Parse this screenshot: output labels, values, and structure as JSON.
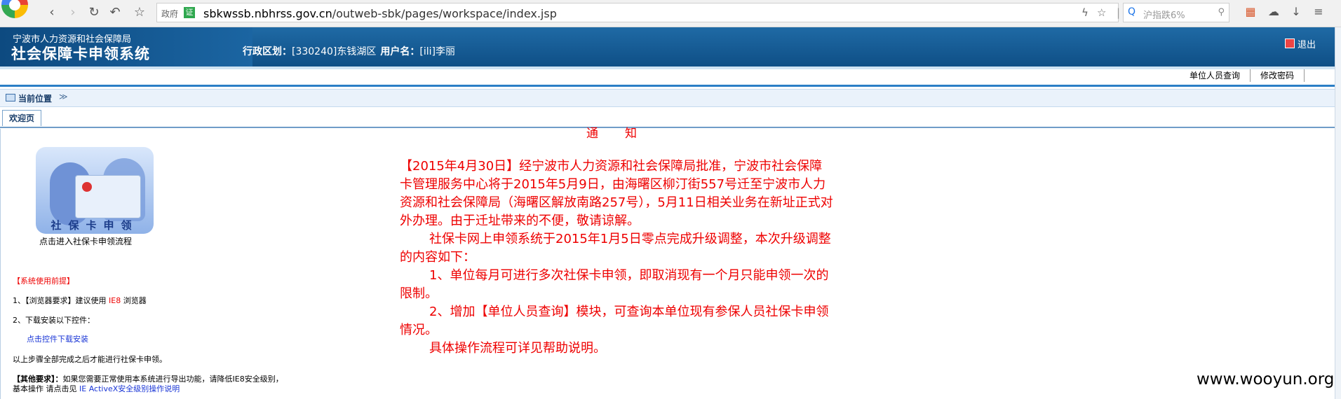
{
  "browser": {
    "gov_badge": "政府",
    "cert_badge": "证",
    "url_host": "sbkwssb.nbhrss.gov.cn",
    "url_path": "/outweb-sbk/pages/workspace/index.jsp",
    "search_placeholder": "沪指跌6%"
  },
  "header": {
    "org_name": "宁波市人力资源和社会保障局",
    "system_name": "社会保障卡申领系统",
    "region_label": "行政区划：",
    "region_value": "[330240]东钱湖区",
    "user_label": "用户名：",
    "user_value": "[ili]李丽",
    "logout_label": "退出"
  },
  "sublinks": {
    "staff_query": "单位人员查询",
    "change_password": "修改密码"
  },
  "breadcrumb": {
    "label": "当前位置",
    "arrows": "≫"
  },
  "tabs": [
    {
      "label": "欢迎页"
    }
  ],
  "card": {
    "caption_text": "社保卡申领",
    "link_text": "点击进入社保卡申领流程"
  },
  "notes": {
    "heading": "【系统使用前提】",
    "item1_prefix": "1、【浏览器要求】建议使用 ",
    "item1_ie": "IE8",
    "item1_suffix": " 浏览器",
    "item2": "2、下载安装以下控件：",
    "download_link": "点击控件下载安装",
    "done": "以上步骤全部完成之后才能进行社保卡申领。",
    "other_prefix": "【其他要求】：",
    "other_text": "如果您需要正常使用本系统进行导出功能，请降低IE8安全级别，",
    "basic_op": "基本操作 请点击见 ",
    "ie_link": "IE ActiveX安全级别操作说明"
  },
  "notice": {
    "title_chars": [
      "通",
      "知"
    ],
    "p1": "【2015年4月30日】经宁波市人力资源和社会保障局批准，宁波市社会保障卡管理服务中心将于2015年5月9日，由海曙区柳汀街557号迁至宁波市人力资源和社会保障局（海曙区解放南路257号），5月11日相关业务在新址正式对外办理。由于迁址带来的不便，敬请谅解。",
    "p2": "社保卡网上申领系统于2015年1月5日零点完成升级调整，本次升级调整的内容如下：",
    "p3": "1、单位每月可进行多次社保卡申领，即取消现有一个月只能申领一次的限制。",
    "p4": "2、增加【单位人员查询】模块，可查询本单位现有参保人员社保卡申领情况。",
    "p5": "具体操作流程可详见帮助说明。"
  },
  "watermark": "www.wooyun.org"
}
